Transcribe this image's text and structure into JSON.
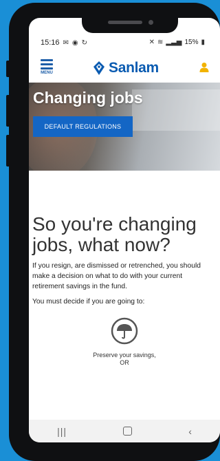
{
  "statusbar": {
    "time": "15:16",
    "battery": "15%"
  },
  "header": {
    "menu_label": "MENU",
    "brand": "Sanlam",
    "brand_color": "#0a5bb1",
    "user_icon_color": "#f2b300",
    "icons": {
      "menu": "hamburger-menu-icon",
      "logo": "sanlam-logo-icon",
      "user": "user-icon"
    }
  },
  "hero": {
    "title": "Changing jobs",
    "button_label": "DEFAULT REGULATIONS",
    "button_color": "#1466c5"
  },
  "main": {
    "headline": "So you're changing jobs, what now?",
    "paragraph1": "If you resign, are dismissed or retrenched, you should make a decision on what to do with your current retirement savings in the fund.",
    "paragraph2": "You must decide if you are going to:",
    "options": [
      {
        "icon": "umbrella-icon",
        "label": "Preserve your savings,",
        "suffix": "OR"
      }
    ]
  },
  "navbar": {
    "icons": [
      "recent-apps-icon",
      "home-icon",
      "back-icon"
    ]
  }
}
